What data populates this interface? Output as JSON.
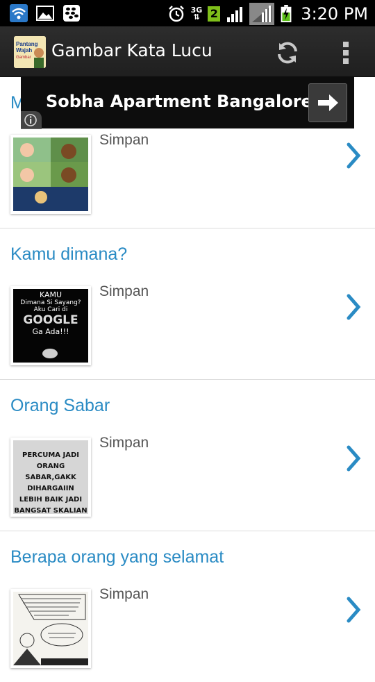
{
  "status_bar": {
    "network": "3G",
    "sim_badge": "2",
    "time": "3:20 PM"
  },
  "action_bar": {
    "title": "Gambar Kata Lucu",
    "app_icon_text": "Pantang Wajah Gambar Kata"
  },
  "ad": {
    "text": "Sobha Apartment Bangalore"
  },
  "list": {
    "items": [
      {
        "title": "M",
        "save_label": "Simpan"
      },
      {
        "title": "Kamu dimana?",
        "save_label": "Simpan"
      },
      {
        "title": "Orang Sabar",
        "save_label": "Simpan"
      },
      {
        "title": "Berapa orang yang selamat",
        "save_label": "Simpan"
      }
    ]
  },
  "thumbs": {
    "kamu": [
      "KAMU",
      "Dimana Si Sayang?",
      "Aku Cari di",
      "GOOGLE",
      "Ga Ada!!!"
    ],
    "sabar": [
      "PERCUMA JADI",
      "ORANG SABAR,GAKK",
      "DIHARGAIIN",
      "LEBIH BAIK JADI",
      "BANGSAT SKALIAN"
    ]
  }
}
